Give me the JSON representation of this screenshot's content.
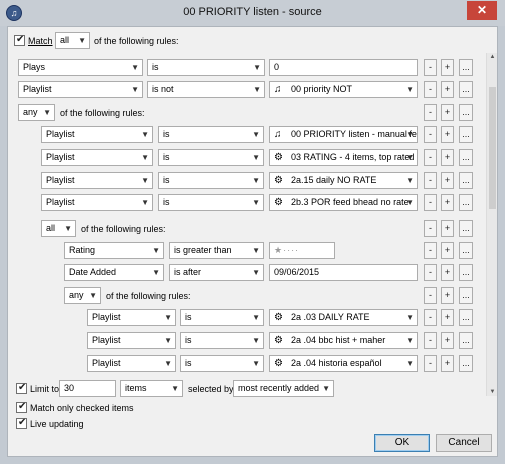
{
  "window": {
    "title": "00 PRIORITY listen - source",
    "close": "✕"
  },
  "top": {
    "match_label": "Match",
    "match_value": "all",
    "of_following": "of the following rules:"
  },
  "rules": [
    {
      "field": "Plays",
      "op": "is",
      "value": "0"
    },
    {
      "field": "Playlist",
      "op": "is not",
      "value": "00 priority NOT"
    }
  ],
  "group1": {
    "any_value": "any",
    "of_following": "of the following rules:",
    "rules": [
      {
        "field": "Playlist",
        "op": "is",
        "value": "00 PRIORITY listen - manual fe"
      },
      {
        "field": "Playlist",
        "op": "is",
        "value": "03 RATING - 4 items, top rated"
      },
      {
        "field": "Playlist",
        "op": "is",
        "value": "2a.15 daily NO RATE"
      },
      {
        "field": "Playlist",
        "op": "is",
        "value": "2b.3 POR feed bhead no rate"
      }
    ]
  },
  "group2": {
    "all_value": "all",
    "of_following": "of the following rules:",
    "rules": [
      {
        "field": "Rating",
        "op": "is greater than",
        "value": "★····"
      },
      {
        "field": "Date Added",
        "op": "is after",
        "value": "09/06/2015"
      }
    ]
  },
  "group3": {
    "any_value": "any",
    "of_following": "of the following rules:",
    "rules": [
      {
        "field": "Playlist",
        "op": "is",
        "value": "2a .03 DAILY RATE"
      },
      {
        "field": "Playlist",
        "op": "is",
        "value": "2a .04 bbc hist + maher"
      },
      {
        "field": "Playlist",
        "op": "is",
        "value": "2a .04 historia español"
      }
    ]
  },
  "rowbuttons": {
    "minus": "-",
    "plus": "+",
    "more": "..."
  },
  "bottom": {
    "limit_label": "Limit to",
    "limit_value": "30",
    "unit": "items",
    "selected_by": "selected by",
    "selected_value": "most recently added",
    "match_checked": "Match only checked items",
    "live_updating": "Live updating",
    "ok": "OK",
    "cancel": "Cancel"
  },
  "icons": {
    "playlist_icon": "playlist-icon",
    "smart_icon": "gear-icon",
    "arrow": "▼"
  }
}
